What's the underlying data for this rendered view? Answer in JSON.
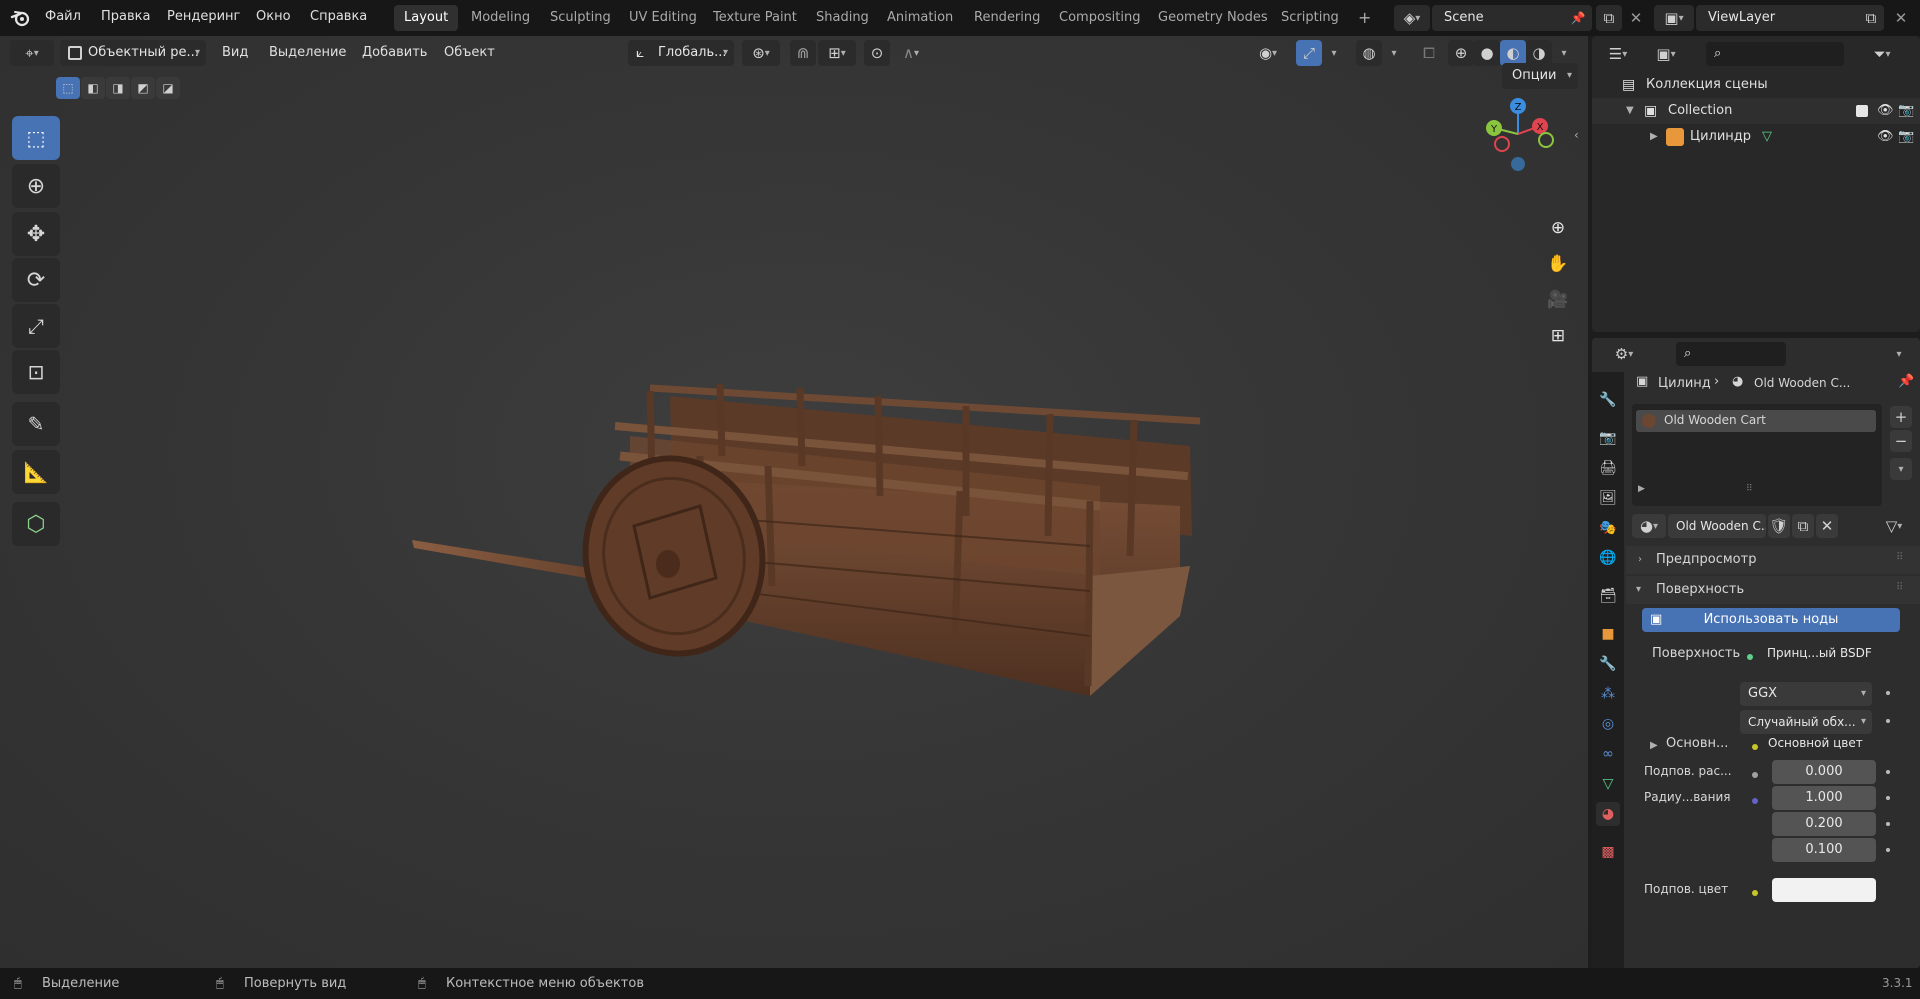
{
  "menu": {
    "file": "Файл",
    "edit": "Правка",
    "render": "Рендеринг",
    "window": "Окно",
    "help": "Справка"
  },
  "workspaces": [
    "Layout",
    "Modeling",
    "Sculpting",
    "UV Editing",
    "Texture Paint",
    "Shading",
    "Animation",
    "Rendering",
    "Compositing",
    "Geometry Nodes",
    "Scripting"
  ],
  "add_workspace": "+",
  "scene": {
    "name": "Scene"
  },
  "view_layer": {
    "name": "ViewLayer"
  },
  "viewport": {
    "mode": "Объектный ре...",
    "menus": [
      "Вид",
      "Выделение",
      "Добавить",
      "Объект"
    ],
    "transform_orientation": "Глобаль...",
    "options": "Опции",
    "gizmo_axes": {
      "x": "X",
      "y": "Y",
      "z": "Z"
    }
  },
  "outliner": {
    "scene_collection": "Коллекция сцены",
    "collection": "Collection",
    "object": "Цилиндр"
  },
  "properties": {
    "breadcrumb_object": "Цилинд",
    "breadcrumb_material": "Old Wooden C...",
    "material_slot": "Old Wooden Cart",
    "material_name": "Old Wooden C...",
    "preview": "Предпросмотр",
    "surface_panel": "Поверхность",
    "use_nodes": "Использовать ноды",
    "surface_label": "Поверхность",
    "surface_value": "Принц...ый BSDF",
    "distribution": "GGX",
    "subsurface_method": "Случайный обх...",
    "base_label": "Основн...",
    "base_value": "Основной цвет",
    "subsurface_label": "Подпов. рас...",
    "subsurface_value": "0.000",
    "radius_label": "Радиу...вания",
    "radius_values": [
      "1.000",
      "0.200",
      "0.100"
    ],
    "subsurface_color_label": "Подпов. цвет"
  },
  "status": {
    "select": "Выделение",
    "rotate_view": "Повернуть вид",
    "context_menu": "Контекстное меню объектов",
    "version": "3.3.1"
  },
  "colors": {
    "accent": "#4772b3",
    "x_axis": "#e0444f",
    "y_axis": "#8bc53f",
    "z_axis": "#3b8de0",
    "wood": "#6b4630"
  }
}
